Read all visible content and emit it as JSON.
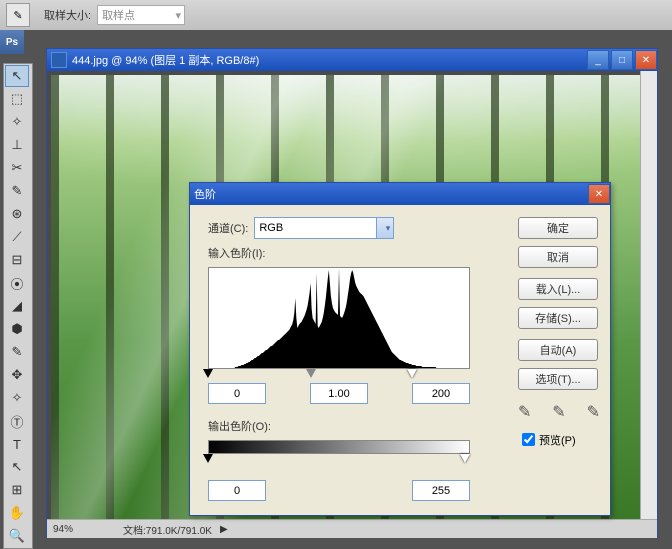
{
  "opts": {
    "sample_label": "取样大小:",
    "sample_value": "取样点"
  },
  "doc": {
    "title": "444.jpg @ 94% (图层 1 副本, RGB/8#)",
    "zoom": "94%",
    "docsize": "文档:791.0K/791.0K"
  },
  "dialog": {
    "title": "色阶",
    "channel_label": "通道(C):",
    "channel_value": "RGB",
    "input_label": "输入色阶(I):",
    "output_label": "输出色阶(O):",
    "in": {
      "black": "0",
      "gamma": "1.00",
      "white": "200"
    },
    "out": {
      "black": "0",
      "white": "255"
    },
    "btns": {
      "ok": "确定",
      "cancel": "取消",
      "load": "载入(L)...",
      "save": "存储(S)...",
      "auto": "自动(A)",
      "options": "选项(T)..."
    },
    "preview": "预览(P)"
  },
  "tools": [
    "↖",
    "⬚",
    "✧",
    "⊥",
    "✂",
    "✎",
    "⊛",
    "⟋",
    "⊟",
    "⦿",
    "◢",
    "⬢",
    "✎",
    "✥",
    "✧",
    "Ⓣ",
    "T",
    "↖",
    "⊞",
    "✋",
    "🔍"
  ],
  "chart_data": {
    "type": "histogram",
    "title": "输入色阶",
    "xlabel": "",
    "ylabel": "",
    "xlim": [
      0,
      255
    ],
    "ylim": [
      0,
      100
    ],
    "values": [
      0,
      0,
      0,
      0,
      0,
      0,
      0,
      0,
      0,
      0,
      0,
      0,
      0,
      0,
      0,
      0,
      0,
      0,
      0,
      0,
      0,
      0,
      0,
      0,
      0,
      0,
      1,
      1,
      1,
      2,
      2,
      2,
      3,
      3,
      3,
      4,
      4,
      5,
      5,
      6,
      6,
      7,
      8,
      8,
      9,
      10,
      10,
      11,
      12,
      12,
      13,
      14,
      15,
      15,
      16,
      17,
      18,
      18,
      19,
      20,
      21,
      22,
      22,
      23,
      24,
      25,
      26,
      27,
      28,
      28,
      29,
      30,
      31,
      32,
      33,
      34,
      35,
      36,
      37,
      38,
      40,
      42,
      44,
      48,
      55,
      70,
      50,
      40,
      42,
      44,
      45,
      46,
      48,
      50,
      52,
      55,
      58,
      62,
      68,
      75,
      85,
      60,
      50,
      48,
      46,
      44,
      95,
      42,
      40,
      42,
      44,
      46,
      50,
      55,
      62,
      70,
      80,
      90,
      98,
      85,
      72,
      65,
      60,
      58,
      56,
      55,
      54,
      53,
      100,
      52,
      51,
      50,
      52,
      55,
      58,
      62,
      68,
      75,
      82,
      90,
      95,
      98,
      95,
      90,
      85,
      82,
      80,
      78,
      76,
      75,
      74,
      73,
      72,
      70,
      68,
      66,
      64,
      62,
      60,
      58,
      56,
      54,
      52,
      50,
      48,
      46,
      44,
      42,
      40,
      38,
      36,
      34,
      32,
      30,
      28,
      26,
      24,
      22,
      20,
      18,
      16,
      15,
      14,
      13,
      12,
      11,
      10,
      9,
      8,
      8,
      7,
      7,
      6,
      6,
      5,
      5,
      5,
      4,
      4,
      4,
      3,
      3,
      3,
      3,
      2,
      2,
      2,
      2,
      2,
      2,
      1,
      1,
      1,
      1,
      1,
      1,
      1,
      1,
      1,
      1,
      1,
      1,
      1,
      1,
      0,
      0,
      0,
      0,
      0,
      0,
      0,
      0,
      0,
      0,
      0,
      0,
      0,
      0,
      0,
      0,
      0,
      0,
      0,
      0,
      0,
      0,
      0,
      0,
      0,
      0,
      0,
      0,
      0,
      0,
      0,
      0
    ]
  }
}
